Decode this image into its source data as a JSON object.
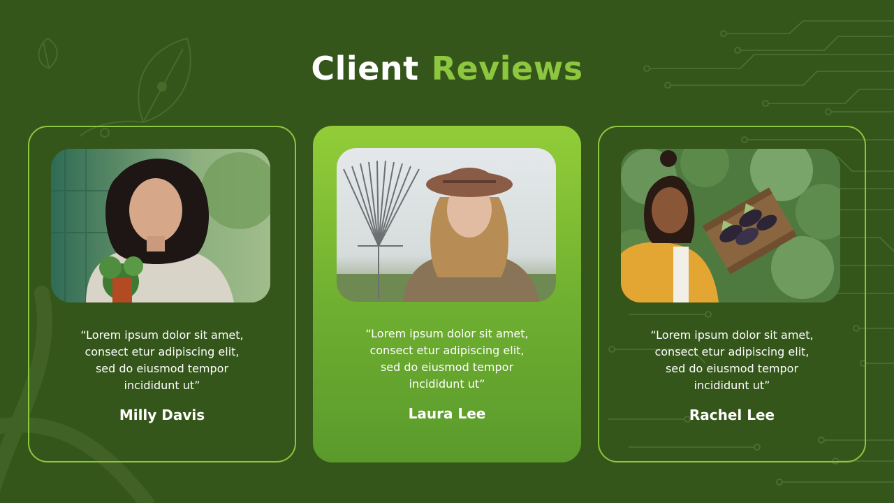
{
  "slide": {
    "title_word1": "Client",
    "title_word2": "Reviews",
    "colors": {
      "background": "#35561a",
      "accent": "#8dc63f",
      "text": "#ffffff"
    },
    "reviews": [
      {
        "quote_lines": [
          "“Lorem ipsum dolor sit amet,",
          "consect etur adipiscing elit,",
          "sed do eiusmod tempor",
          "incididunt ut”"
        ],
        "name": "Milly Davis",
        "style": "outline",
        "photo": "woman-holding-potted-plant-photo"
      },
      {
        "quote_lines": [
          "“Lorem ipsum dolor sit amet,",
          "consect etur adipiscing elit,",
          "sed do eiusmod tempor",
          "incididunt ut”"
        ],
        "name": "Laura Lee",
        "style": "filled",
        "photo": "woman-with-hat-and-rake-photo"
      },
      {
        "quote_lines": [
          "“Lorem ipsum dolor sit amet,",
          "consect etur adipiscing elit,",
          "sed do eiusmod tempor",
          "incididunt ut”"
        ],
        "name": "Rachel Lee",
        "style": "outline",
        "photo": "woman-holding-vegetable-crate-photo"
      }
    ]
  }
}
